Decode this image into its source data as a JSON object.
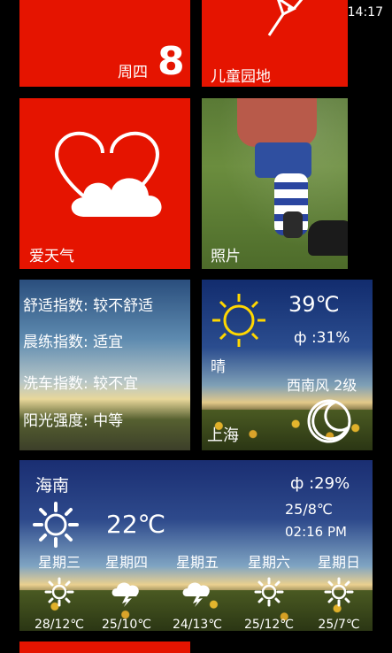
{
  "status_bar": {
    "time": "14:17"
  },
  "calendar_tile": {
    "weekday": "周四",
    "day": "8"
  },
  "kids_tile": {
    "label": "儿童园地"
  },
  "weather_love_tile": {
    "label": "爱天气"
  },
  "photos_tile": {
    "label": "照片"
  },
  "index_tile": {
    "items": [
      "舒适指数: 较不舒适",
      "晨练指数: 适宜",
      "洗车指数: 较不宜",
      "阳光强度: 中等"
    ]
  },
  "shanghai_tile": {
    "temp": "39℃",
    "humidity": "ф :31%",
    "condition": "晴",
    "wind": "西南风 2级",
    "city": "上海"
  },
  "hainan_tile": {
    "city": "海南",
    "humidity": "ф :29%",
    "temp": "22℃",
    "date": "25/8℃",
    "time": "02:16 PM",
    "forecast": [
      {
        "day": "星期三",
        "icon": "sun-icon",
        "range": "28/12℃"
      },
      {
        "day": "星期四",
        "icon": "thunderstorm-icon",
        "range": "25/10℃"
      },
      {
        "day": "星期五",
        "icon": "thunderstorm-icon",
        "range": "24/13℃"
      },
      {
        "day": "星期六",
        "icon": "sun-icon",
        "range": "25/12℃"
      },
      {
        "day": "星期日",
        "icon": "sun-icon",
        "range": "25/7℃"
      }
    ]
  }
}
